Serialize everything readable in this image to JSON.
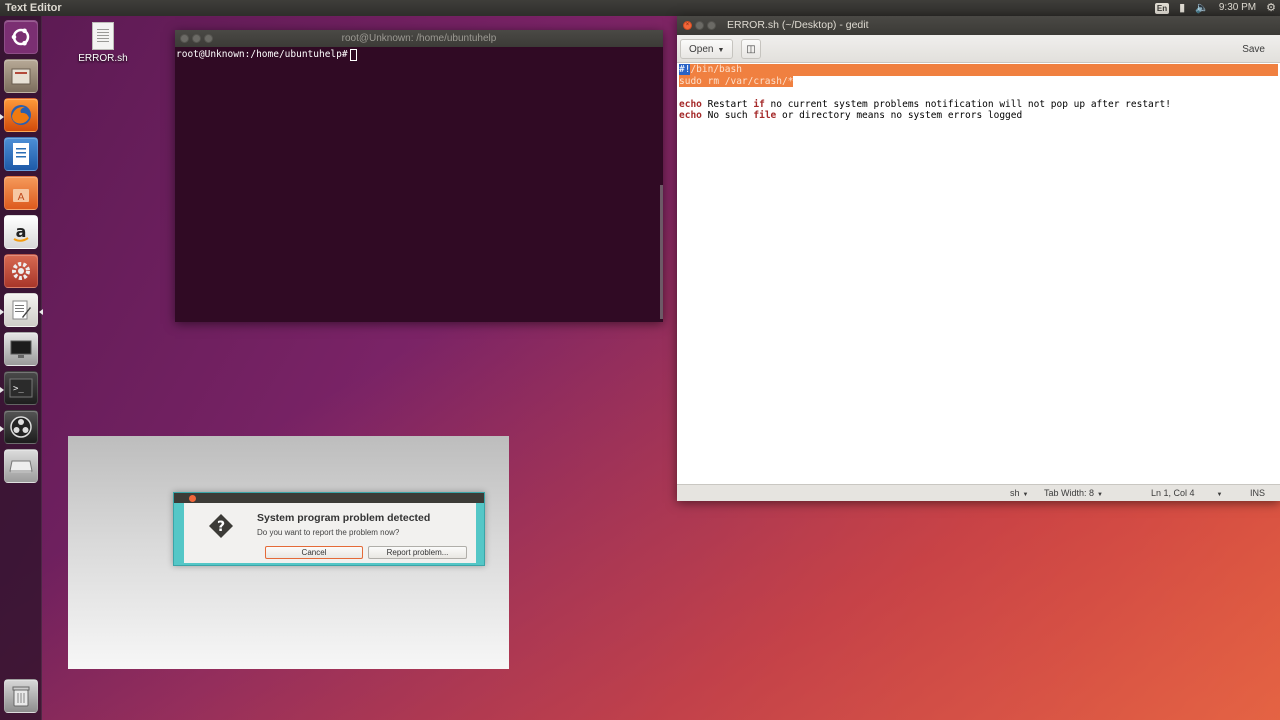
{
  "top_panel": {
    "app_title": "Text Editor",
    "keyboard_layout": "En",
    "clock": "9:30 PM"
  },
  "launcher": {
    "items": [
      {
        "name": "dash",
        "icon": "ubuntu-logo-icon",
        "color": "#8a3a7e"
      },
      {
        "name": "files",
        "icon": "file-manager-icon",
        "color": "#8c7f6f"
      },
      {
        "name": "firefox",
        "icon": "firefox-icon",
        "color": "#e66000"
      },
      {
        "name": "writer",
        "icon": "libreoffice-writer-icon",
        "color": "#2a6db5"
      },
      {
        "name": "software-center",
        "icon": "shopping-bag-icon",
        "color": "#e8632a"
      },
      {
        "name": "amazon",
        "icon": "amazon-icon",
        "color": "#f0f0f0"
      },
      {
        "name": "settings",
        "icon": "settings-gear-icon",
        "color": "#c54a3a"
      },
      {
        "name": "text-editor",
        "icon": "text-editor-icon",
        "color": "#e9e8e4"
      },
      {
        "name": "display",
        "icon": "monitor-icon",
        "color": "#3b3b3b"
      },
      {
        "name": "terminal",
        "icon": "terminal-icon",
        "color": "#2c2c2c"
      },
      {
        "name": "obs",
        "icon": "obs-icon",
        "color": "#2a2a2a"
      },
      {
        "name": "drive",
        "icon": "drive-icon",
        "color": "#bdbdbd"
      },
      {
        "name": "trash",
        "icon": "trash-icon",
        "color": "#9a9a9a"
      }
    ]
  },
  "desktop": {
    "file_label": "ERROR.sh"
  },
  "terminal": {
    "title": "root@Unknown: /home/ubuntuhelp",
    "prompt": "root@Unknown:/home/ubuntuhelp#"
  },
  "gedit": {
    "title": "ERROR.sh (~/Desktop) - gedit",
    "open_label": "Open",
    "save_label": "Save",
    "code": {
      "line1_a": "#!",
      "line1_b": "/bin/bash",
      "line2": "sudo rm /var/crash/*",
      "line4_kw": "echo",
      "line4_a": " Restart ",
      "line4_kw2": "if",
      "line4_b": " no current system problems notification will not pop up after restart!",
      "line5_kw": "echo",
      "line5_a": " No such ",
      "line5_kw2": "file",
      "line5_b": " or directory means no system errors logged"
    },
    "status": {
      "language": "sh",
      "tab_width": "Tab Width: 8",
      "position": "Ln 1, Col 4",
      "mode": "INS"
    }
  },
  "dialog": {
    "title": "System program problem detected",
    "message": "Do you want to report the problem now?",
    "cancel_label": "Cancel",
    "report_label": "Report problem..."
  }
}
